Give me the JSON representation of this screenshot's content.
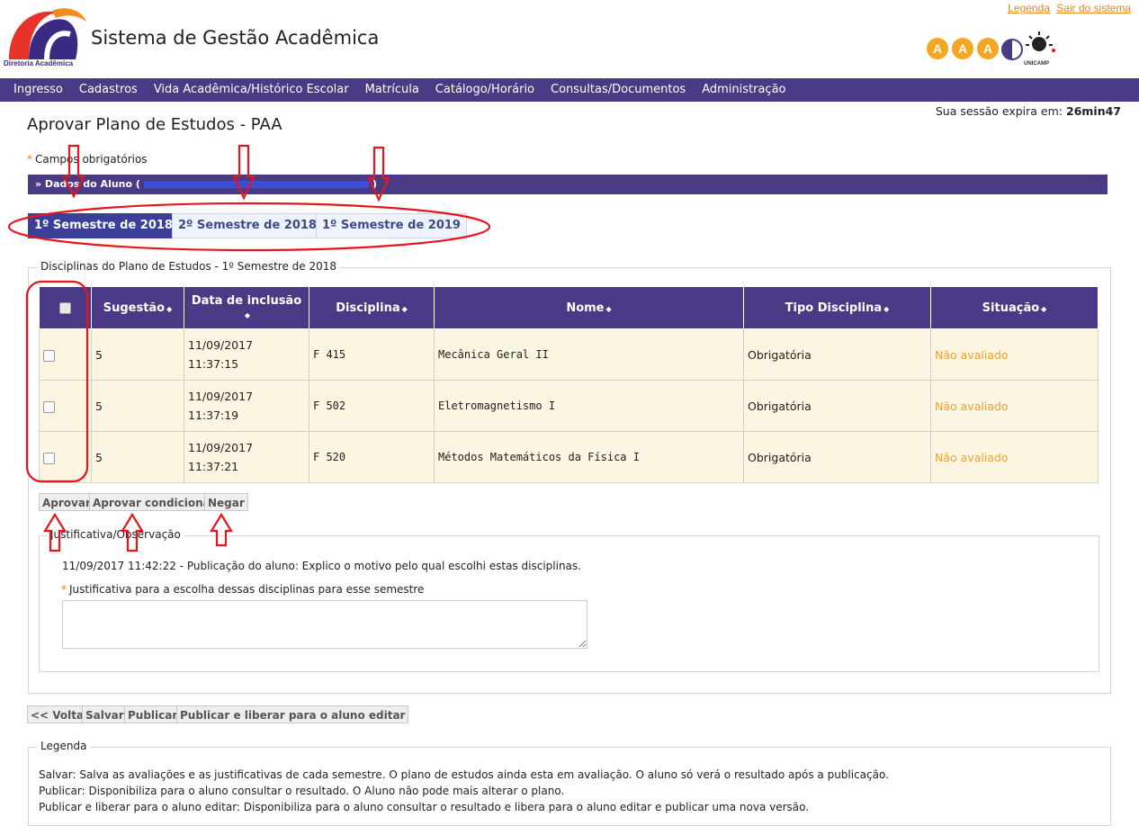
{
  "header": {
    "logo_caption": "Diretoria Acadêmica",
    "system_title": "Sistema de Gestão Acadêmica",
    "links": [
      "Legenda",
      "Sair do sistema"
    ],
    "aaa_letters": [
      "A",
      "A",
      "A"
    ],
    "unicamp_label": "UNICAMP"
  },
  "nav": {
    "items": [
      "Ingresso",
      "Cadastros",
      "Vida Acadêmica/Histórico Escolar",
      "Matrícula",
      "Catálogo/Horário",
      "Consultas/Documentos",
      "Administração"
    ]
  },
  "session": {
    "label": "Sua sessão expira em:",
    "time": "26min47"
  },
  "page": {
    "title": "Aprovar Plano de Estudos - PAA",
    "required_note": "Campos obrigatórios",
    "aluno_bar_prefix": "»  Dados do Aluno (",
    "aluno_bar_suffix": ")"
  },
  "tabs": [
    {
      "label": "1º Semestre de 2018",
      "active": true
    },
    {
      "label": "2º Semestre de 2018",
      "active": false
    },
    {
      "label": "1º Semestre de 2019",
      "active": false
    }
  ],
  "disciplinas": {
    "legend": "Disciplinas do Plano de Estudos - 1º Semestre de 2018",
    "columns": [
      "Sugestão",
      "Data de inclusão",
      "Disciplina",
      "Nome",
      "Tipo Disciplina",
      "Situação"
    ],
    "rows": [
      {
        "sugestao": "5",
        "data": "11/09/2017",
        "hora": "11:37:15",
        "disciplina": "F 415",
        "nome": "Mecânica Geral II",
        "tipo": "Obrigatória",
        "situacao": "Não avaliado"
      },
      {
        "sugestao": "5",
        "data": "11/09/2017",
        "hora": "11:37:19",
        "disciplina": "F 502",
        "nome": "Eletromagnetismo I",
        "tipo": "Obrigatória",
        "situacao": "Não avaliado"
      },
      {
        "sugestao": "5",
        "data": "11/09/2017",
        "hora": "11:37:21",
        "disciplina": "F 520",
        "nome": "Métodos Matemáticos da Física I",
        "tipo": "Obrigatória",
        "situacao": "Não avaliado"
      }
    ],
    "buttons": [
      "Aprovar",
      "Aprovar condicional",
      "Negar"
    ]
  },
  "justificativa": {
    "legend": "Justificativa/Observação",
    "history": "11/09/2017 11:42:22 - Publicação do aluno: Explico o motivo pelo qual escolhi estas disciplinas.",
    "field_label": "Justificativa para a escolha dessas disciplinas para esse semestre",
    "value": ""
  },
  "bottom_buttons": [
    "<< Voltar",
    "Salvar",
    "Publicar",
    "Publicar e liberar para o aluno editar"
  ],
  "legenda": {
    "legend": "Legenda",
    "lines": [
      "Salvar: Salva as avaliações e as justificativas de cada semestre. O plano de estudos ainda esta em avaliação. O aluno só verá o resultado após a publicação.",
      "Publicar: Disponibiliza para o aluno consultar o resultado. O Aluno não pode mais alterar o plano.",
      "Publicar e liberar para o aluno editar: Disponibiliza para o aluno consultar o resultado e libera para o aluno editar e publicar uma nova versão."
    ]
  },
  "colors": {
    "brand_purple": "#4a3a86",
    "accent_orange": "#f07d00",
    "status_orange": "#f0a030",
    "annotation_red": "#e8141e"
  }
}
